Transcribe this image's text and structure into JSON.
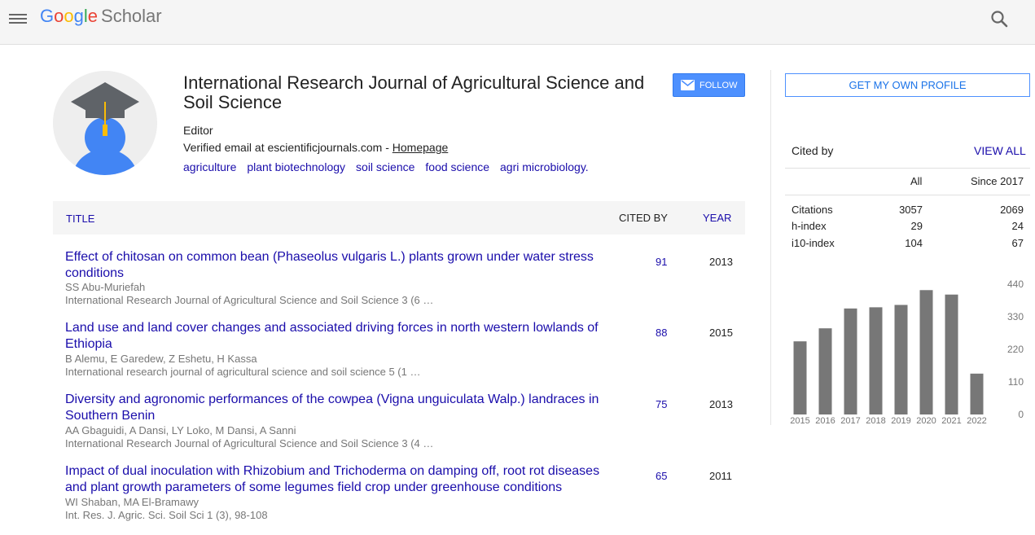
{
  "header": {
    "logo_g1": "G",
    "logo_g2": "o",
    "logo_g3": "o",
    "logo_g4": "g",
    "logo_g5": "l",
    "logo_g6": "e",
    "logo_scholar": "Scholar"
  },
  "profile": {
    "name": "International Research Journal of Agricultural Science and Soil Science",
    "affiliation": "Editor",
    "email": "Verified email at escientificjournals.com - ",
    "homepage": "Homepage",
    "follow_label": "FOLLOW",
    "interests": [
      "agriculture",
      "plant biotechnology",
      "soil science",
      "food science",
      "agri microbiology."
    ]
  },
  "table": {
    "col_title": "TITLE",
    "col_cited": "CITED BY",
    "col_year": "YEAR",
    "rows": [
      {
        "title": "Effect of chitosan on common bean (Phaseolus vulgaris L.) plants grown under water stress conditions",
        "authors": "SS Abu-Muriefah",
        "venue": "International Research Journal of Agricultural Science and Soil Science 3 (6 …",
        "cites": "91",
        "year": "2013"
      },
      {
        "title": "Land use and land cover changes and associated driving forces in north western lowlands of Ethiopia",
        "authors": "B Alemu, E Garedew, Z Eshetu, H Kassa",
        "venue": "International research journal of agricultural science and soil science 5 (1 …",
        "cites": "88",
        "year": "2015"
      },
      {
        "title": "Diversity and agronomic performances of the cowpea (Vigna unguiculata Walp.) landraces in Southern Benin",
        "authors": "AA Gbaguidi, A Dansi, LY Loko, M Dansi, A Sanni",
        "venue": "International Research Journal of Agricultural Science and Soil Science 3 (4 …",
        "cites": "75",
        "year": "2013"
      },
      {
        "title": "Impact of dual inoculation with Rhizobium and Trichoderma on damping off, root rot diseases and plant growth parameters of some legumes field crop under greenhouse conditions",
        "authors": "WI Shaban, MA El-Bramawy",
        "venue": "Int. Res. J. Agric. Sci. Soil Sci 1 (3), 98-108",
        "cites": "65",
        "year": "2011"
      }
    ]
  },
  "sidebar": {
    "get_profile": "GET MY OWN PROFILE",
    "cited_by": "Cited by",
    "view_all": "VIEW ALL",
    "col_all": "All",
    "col_since": "Since 2017",
    "stats": [
      {
        "label": "Citations",
        "all": "3057",
        "since": "2069"
      },
      {
        "label": "h-index",
        "all": "29",
        "since": "24"
      },
      {
        "label": "i10-index",
        "all": "104",
        "since": "67"
      }
    ]
  },
  "chart_data": {
    "type": "bar",
    "categories": [
      "2015",
      "2016",
      "2017",
      "2018",
      "2019",
      "2020",
      "2021",
      "2022"
    ],
    "values": [
      247,
      291,
      358,
      362,
      370,
      420,
      405,
      138
    ],
    "ylim": [
      0,
      440
    ],
    "yticks": [
      "0",
      "110",
      "220",
      "330",
      "440"
    ],
    "bar_color": "#777777"
  }
}
